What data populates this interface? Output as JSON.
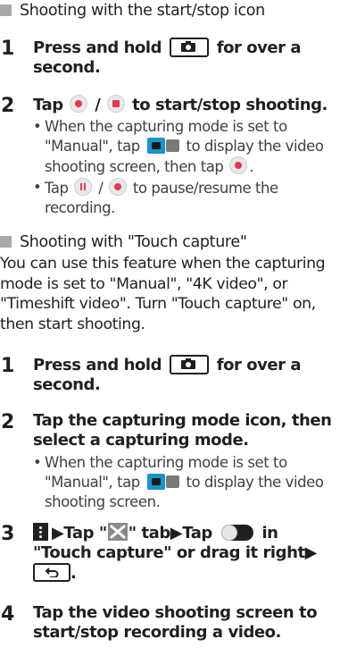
{
  "section1": {
    "heading": "Shooting with the start/stop icon",
    "step1": {
      "num": "1",
      "pre": "Press and hold",
      "post": "for over a",
      "line2": "second."
    },
    "step2": {
      "num": "2",
      "pre": "Tap",
      "sep": "/",
      "post": "to start/stop shooting.",
      "bullet1": {
        "line1": "When the capturing mode is set to",
        "line2_pre": "\"Manual\", tap",
        "line2_post": "to display the video",
        "line3_pre": "shooting screen, then tap",
        "line3_post": "."
      },
      "bullet2": {
        "line1_pre": "Tap",
        "line1_sep": "/",
        "line1_post": "to pause/resume the",
        "line2": "recording."
      }
    }
  },
  "section2": {
    "heading": "Shooting with \"Touch capture\"",
    "intro": [
      "You can use this feature when the capturing",
      "mode is set to \"Manual\", \"4K video\", or",
      "\"Timeshift video\". Turn \"Touch capture\" on,",
      "then start shooting."
    ],
    "step1": {
      "num": "1",
      "pre": "Press and hold",
      "post": "for over a",
      "line2": "second."
    },
    "step2": {
      "num": "2",
      "line1": "Tap the capturing mode icon, then",
      "line2": "select a capturing mode.",
      "bullet1": {
        "line1": "When the capturing mode is set to",
        "line2_pre": "\"Manual\", tap",
        "line2_post": "to display the video",
        "line3": "shooting screen."
      }
    },
    "step3": {
      "num": "3",
      "arrow1": "▶Tap \"",
      "tab_suffix": "\" tab▶Tap",
      "line2": "\"Touch capture\" or drag it right▶"
    },
    "step4": {
      "num": "4",
      "line1": "Tap the video shooting screen to",
      "line2": "start/stop recording a video."
    }
  },
  "bullet_char": "•",
  "icons": {
    "camera_key": "camera-key-icon",
    "record": "record-button-icon",
    "stop": "stop-button-icon",
    "pause": "pause-button-icon",
    "mode_switch": "video-mode-switch-icon",
    "menu": "menu-icon",
    "settings_tab": "settings-tab-icon",
    "toggle": "toggle-switch-icon",
    "back_key": "back-key-icon"
  },
  "colors": {
    "text": "#231f20",
    "bullet_text": "#414042",
    "record_red": "#e5384f",
    "mode_blue": "#1595c9",
    "square": "#a7a9ac"
  }
}
